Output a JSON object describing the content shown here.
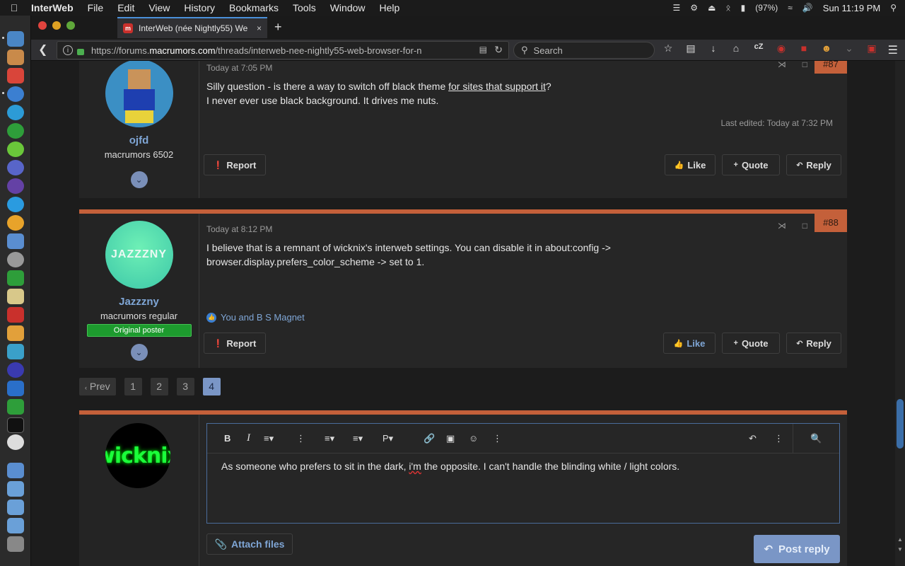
{
  "menubar": {
    "app_name": "InterWeb",
    "items": [
      "File",
      "Edit",
      "View",
      "History",
      "Bookmarks",
      "Tools",
      "Window",
      "Help"
    ],
    "battery": "(97%)",
    "clock": "Sun 11:19 PM"
  },
  "browser": {
    "tab_title": "InterWeb (née Nightly55) We",
    "tab_close": "×",
    "new_tab": "+",
    "url_prefix": "https://forums.",
    "url_domain": "macrumors.com",
    "url_path": "/threads/interweb-nee-nightly55-web-browser-for-n",
    "search_placeholder": "Search"
  },
  "posts": [
    {
      "number": "#87",
      "date": "Today at 7:05 PM",
      "username": "ojfd",
      "user_title": "macrumors 6502",
      "body_line1_before": "Silly question - is there a way to switch off black theme ",
      "body_link": "for sites that support it",
      "body_line1_after": "?",
      "body_line2": "I never ever use black background. It drives me nuts.",
      "edited": "Last edited: Today at 7:32 PM",
      "report": "Report",
      "like": "Like",
      "quote": "Quote",
      "reply": "Reply"
    },
    {
      "number": "#88",
      "date": "Today at 8:12 PM",
      "username": "Jazzzny",
      "user_title": "macrumors regular",
      "badge": "Original poster",
      "avatar_text": "JAZZZNY",
      "body_line1": "I believe that is a remnant of wicknix's interweb settings. You can disable it in about:config ->",
      "body_line2": "browser.display.prefers_color_scheme -> set to 1.",
      "reactions": "You and B S Magnet",
      "report": "Report",
      "like": "Like",
      "quote": "Quote",
      "reply": "Reply"
    }
  ],
  "pagination": {
    "prev": "Prev",
    "pages": [
      "1",
      "2",
      "3",
      "4"
    ],
    "current": "4"
  },
  "reply_box": {
    "avatar_text": "wicknix",
    "text_before": "As someone who prefers to sit in the dark, ",
    "text_misspelled": "i'm",
    "text_after": " the opposite. I can't handle the blinding white / light colors.",
    "attach": "Attach files",
    "post_reply": "Post reply"
  },
  "colors": {
    "accent": "#c4603a",
    "link": "#7fa6d6",
    "button_primary": "#7a96c6",
    "badge_green": "#1d9b2e"
  }
}
